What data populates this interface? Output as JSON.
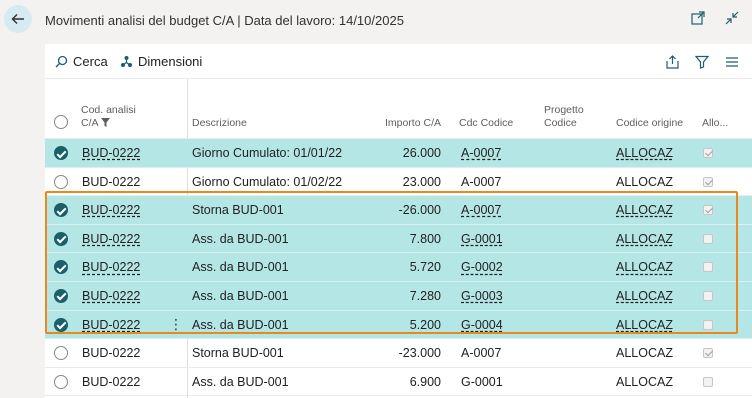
{
  "header": {
    "title": "Movimenti analisi del budget C/A | Data del lavoro: 14/10/2025"
  },
  "toolbar": {
    "search_label": "Cerca",
    "dimensions_label": "Dimensioni"
  },
  "columns": {
    "budget": "Cod. analisi C/A",
    "description": "Descrizione",
    "amount": "Importo C/A",
    "cdc": "Cdc Codice",
    "project": "Progetto Codice",
    "origin": "Codice origine",
    "allocation": "Allo..."
  },
  "rows": [
    {
      "budget": "BUD-0222",
      "description": "Giorno Cumulato: 01/01/22",
      "amount": "26.000",
      "cdc": "A-0007",
      "origin": "ALLOCAZ",
      "selected": true,
      "checked": true
    },
    {
      "budget": "BUD-0222",
      "description": "Giorno Cumulato: 01/02/22",
      "amount": "23.000",
      "cdc": "A-0007",
      "origin": "ALLOCAZ",
      "selected": false,
      "checked": true
    },
    {
      "budget": "BUD-0222",
      "description": "Storna BUD-001",
      "amount": "-26.000",
      "cdc": "A-0007",
      "origin": "ALLOCAZ",
      "selected": true,
      "checked": true
    },
    {
      "budget": "BUD-0222",
      "description": "Ass. da BUD-001",
      "amount": "7.800",
      "cdc": "G-0001",
      "origin": "ALLOCAZ",
      "selected": true,
      "checked": false
    },
    {
      "budget": "BUD-0222",
      "description": "Ass. da BUD-001",
      "amount": "5.720",
      "cdc": "G-0002",
      "origin": "ALLOCAZ",
      "selected": true,
      "checked": false
    },
    {
      "budget": "BUD-0222",
      "description": "Ass. da BUD-001",
      "amount": "7.280",
      "cdc": "G-0003",
      "origin": "ALLOCAZ",
      "selected": true,
      "checked": false
    },
    {
      "budget": "BUD-0222",
      "description": "Ass. da BUD-001",
      "amount": "5.200",
      "cdc": "G-0004",
      "origin": "ALLOCAZ",
      "selected": true,
      "checked": false
    },
    {
      "budget": "BUD-0222",
      "description": "Storna BUD-001",
      "amount": "-23.000",
      "cdc": "A-0007",
      "origin": "ALLOCAZ",
      "selected": false,
      "checked": true
    },
    {
      "budget": "BUD-0222",
      "description": "Ass. da BUD-001",
      "amount": "6.900",
      "cdc": "G-0001",
      "origin": "ALLOCAZ",
      "selected": false,
      "checked": false
    }
  ]
}
